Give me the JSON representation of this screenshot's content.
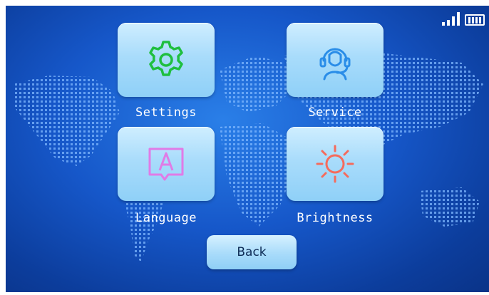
{
  "status_bar": {
    "signal_icon": "signal-bars-icon",
    "battery_icon": "battery-icon"
  },
  "menu": {
    "items": [
      {
        "label": "Settings",
        "icon": "gear-icon",
        "icon_color": "#1fbf3f"
      },
      {
        "label": "Service",
        "icon": "headset-agent-icon",
        "icon_color": "#2a8de8"
      },
      {
        "label": "Language",
        "icon": "letter-a-speech-icon",
        "icon_color": "#e07be6"
      },
      {
        "label": "Brightness",
        "icon": "sun-icon",
        "icon_color": "#f56b5c"
      }
    ]
  },
  "back_label": "Back",
  "colors": {
    "background": "#1657c9",
    "tile": "#a9dcfb",
    "label_text": "#ffffff"
  }
}
